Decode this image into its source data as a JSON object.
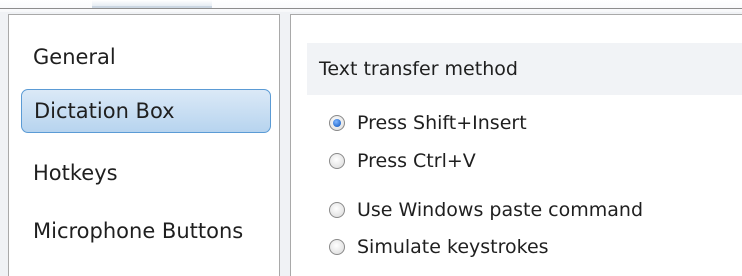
{
  "sidebar": {
    "items": [
      {
        "label": "General"
      },
      {
        "label": "Dictation Box",
        "selected": true
      },
      {
        "label": "Hotkeys"
      },
      {
        "label": "Microphone Buttons"
      }
    ]
  },
  "content": {
    "group_title": "Text transfer method",
    "options": [
      {
        "label": "Press Shift+Insert",
        "checked": true
      },
      {
        "label": "Press Ctrl+V",
        "checked": false
      },
      {
        "label": "Use Windows paste command",
        "checked": false
      },
      {
        "label": "Simulate keystrokes",
        "checked": false
      }
    ]
  },
  "colors": {
    "selection_border": "#5b9bd5",
    "selection_fill": "#c6ddf3",
    "radio_dot": "#2a6fd1"
  }
}
